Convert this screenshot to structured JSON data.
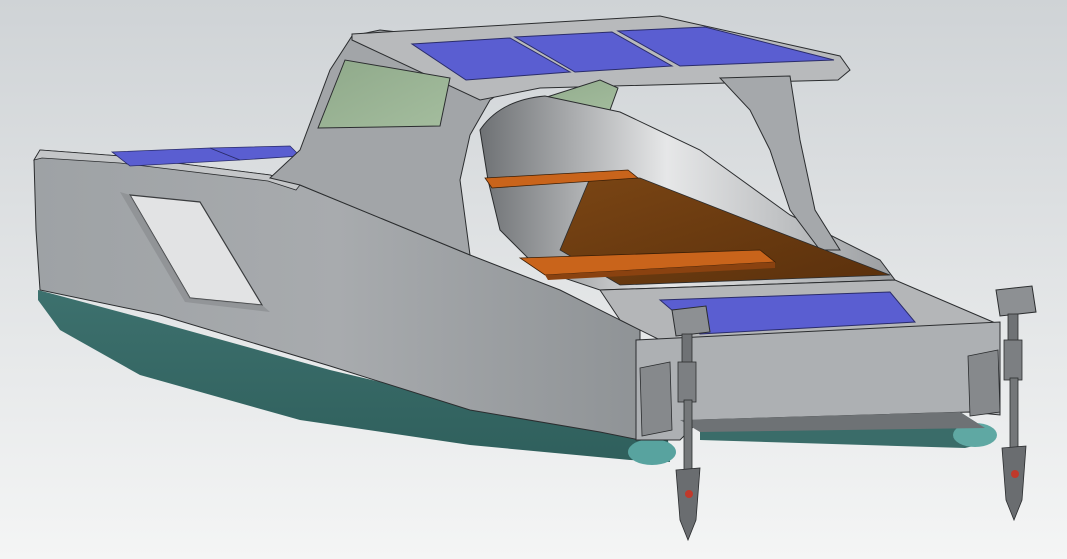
{
  "scene": {
    "subject": "cad-render-solar-catamaran",
    "colors": {
      "background_top": "#cfd3d6",
      "background_bottom": "#f4f5f5",
      "hull_gray": "#a9acaf",
      "hull_dark": "#8e9295",
      "underwater_teal": "#3b6f6c",
      "underwater_light": "#5aa7a3",
      "solar_panel": "#5a5ed1",
      "deck_wood": "#6b3a10",
      "bench_orange": "#c9641b",
      "window_green": "#93ad8e",
      "motor_gray": "#7c7f82"
    }
  }
}
